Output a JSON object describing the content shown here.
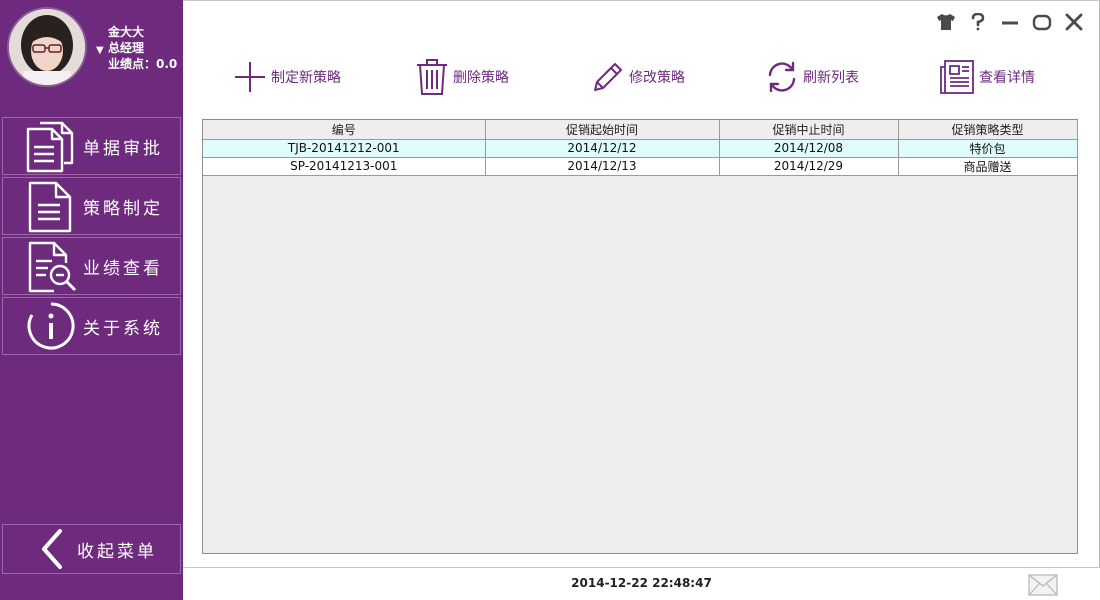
{
  "user": {
    "name": "金大大",
    "role": "总经理",
    "performance": "业绩点：0.0",
    "role_arrow": "▼"
  },
  "sidebar": {
    "items": [
      {
        "label": "单据审批",
        "icon": "document-list-icon"
      },
      {
        "label": "策略制定",
        "icon": "document-icon"
      },
      {
        "label": "业绩查看",
        "icon": "document-search-icon"
      },
      {
        "label": "关于系统",
        "icon": "info-icon"
      }
    ],
    "collapse_label": "收起菜单",
    "collapse_icon": "chevron-left-icon"
  },
  "window_controls": [
    "skin-icon",
    "help-icon",
    "minimize-icon",
    "maximize-icon",
    "close-icon"
  ],
  "toolbar": {
    "new_label": "制定新策略",
    "delete_label": "删除策略",
    "edit_label": "修改策略",
    "refresh_label": "刷新列表",
    "detail_label": "查看详情"
  },
  "table": {
    "columns": [
      "编号",
      "促销起始时间",
      "促销中止时间",
      "促销策略类型"
    ],
    "rows": [
      [
        "TJB-20141212-001",
        "2014/12/12",
        "2014/12/08",
        "特价包"
      ],
      [
        "SP-20141213-001",
        "2014/12/13",
        "2014/12/29",
        "商品赠送"
      ]
    ],
    "selected_row": 0
  },
  "status": {
    "datetime": "2014-12-22 22:48:47"
  },
  "colors": {
    "sidebar_bg": "#6e2b7e",
    "accent": "#6e2b7e",
    "selected_row": "#dffdfd"
  }
}
